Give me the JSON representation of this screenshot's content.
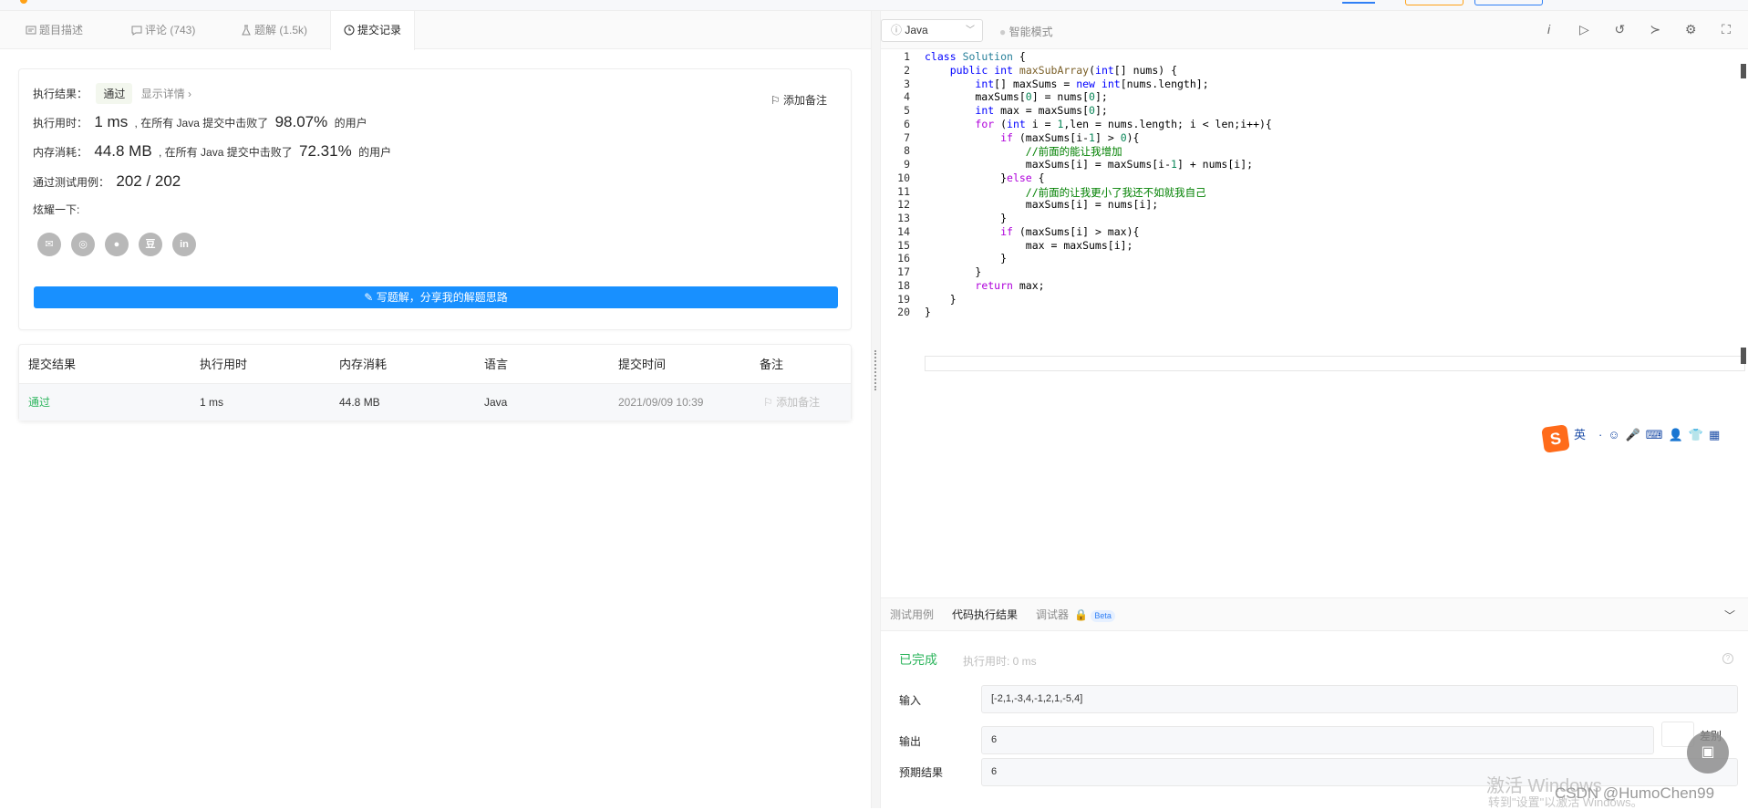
{
  "tabs": [
    {
      "label": "题目描述",
      "icon": "document-icon"
    },
    {
      "label": "评论 (743)",
      "icon": "comment-icon"
    },
    {
      "label": "题解 (1.5k)",
      "icon": "flask-icon"
    },
    {
      "label": "提交记录",
      "icon": "clock-icon"
    }
  ],
  "result": {
    "exec_label": "执行结果：",
    "status": "通过",
    "detail_link": "显示详情 ›",
    "add_note": "添加备注",
    "time_label": "执行用时：",
    "time_value": "1 ms",
    "time_text1": ", 在所有 Java 提交中击败了",
    "time_percent": "98.07%",
    "time_text2": "的用户",
    "mem_label": "内存消耗：",
    "mem_value": "44.8 MB",
    "mem_text1": ", 在所有 Java 提交中击败了",
    "mem_percent": "72.31%",
    "mem_text2": "的用户",
    "tests_label": "通过测试用例：",
    "tests_value": "202 / 202",
    "share_label": "炫耀一下:",
    "write_button": "写题解，分享我的解题思路"
  },
  "table": {
    "headers": [
      "提交结果",
      "执行用时",
      "内存消耗",
      "语言",
      "提交时间",
      "备注"
    ],
    "row": {
      "result": "通过",
      "time": "1 ms",
      "memory": "44.8 MB",
      "language": "Java",
      "submitted": "2021/09/09 10:39",
      "note": "添加备注"
    }
  },
  "editor": {
    "language": "Java",
    "smart_mode": "智能模式",
    "code_lines": [
      "class Solution {",
      "    public int maxSubArray(int[] nums) {",
      "        int[] maxSums = new int[nums.length];",
      "        maxSums[0] = nums[0];",
      "        int max = maxSums[0];",
      "        for (int i = 1,len = nums.length; i < len;i++){",
      "            if (maxSums[i-1] > 0){",
      "                //前面的能让我增加",
      "                maxSums[i] = maxSums[i-1] + nums[i];",
      "            }else {",
      "                //前面的让我更小了我还不如就我自己",
      "                maxSums[i] = nums[i];",
      "            }",
      "            if (maxSums[i] > max){",
      "                max = maxSums[i];",
      "            }",
      "        }",
      "        return max;",
      "    }",
      "}"
    ]
  },
  "ime": {
    "label": "英"
  },
  "console": {
    "tabs": [
      "测试用例",
      "代码执行结果",
      "调试器"
    ],
    "beta": "Beta",
    "status": "已完成",
    "exec_time": "执行用时: 0 ms",
    "input_label": "输入",
    "input_value": "[-2,1,-3,4,-1,2,1,-5,4]",
    "output_label": "输出",
    "output_value": "6",
    "diff_label": "差别",
    "expected_label": "预期结果",
    "expected_value": "6"
  },
  "watermark": {
    "line1": "激活 Windows",
    "line2": "转到\"设置\"以激活 Windows。",
    "csdn": "CSDN @HumoChen99"
  },
  "colors": {
    "accent": "#1890ff",
    "pass": "#2db55d",
    "orange": "#ffa116"
  }
}
